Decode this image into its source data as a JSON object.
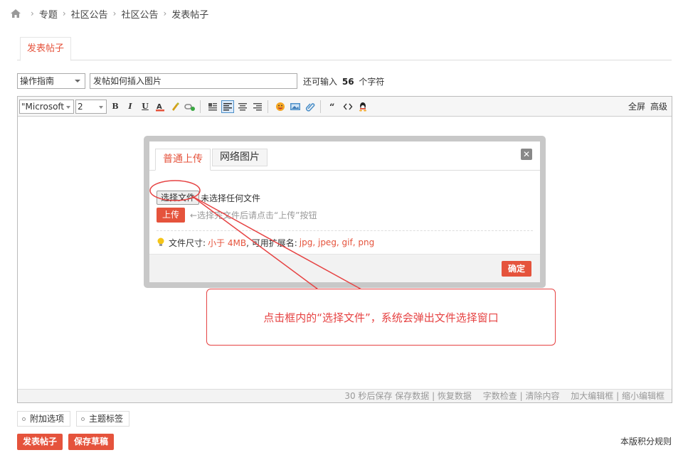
{
  "breadcrumb": {
    "items": [
      "专题",
      "社区公告",
      "社区公告",
      "发表帖子"
    ]
  },
  "tab": {
    "label": "发表帖子"
  },
  "subject": {
    "type_value": "操作指南",
    "title_value": "发帖如何插入图片",
    "remain_prefix": "还可输入",
    "remain_count": "56",
    "remain_suffix": "个字符"
  },
  "toolbar": {
    "font_value": "\"Microsoft",
    "size_value": "2",
    "bold": "B",
    "italic": "I",
    "underline": "U",
    "fullscreen": "全屏",
    "advanced": "高级"
  },
  "statusbar": {
    "autosave": "30 秒后保存",
    "save": "保存数据",
    "restore": "恢复数据",
    "check": "字数检查",
    "clear": "清除内容",
    "enlarge": "加大编辑框",
    "shrink": "缩小编辑框"
  },
  "modal": {
    "tab_local": "普通上传",
    "tab_web": "网络图片",
    "choose_file": "选择文件",
    "no_file": "未选择任何文件",
    "upload": "上传",
    "upload_hint": "←选择完文件后请点击“上传”按钮",
    "size_label": "文件尺寸:",
    "size_value": "小于 4MB",
    "ext_label": ", 可用扩展名:",
    "ext_value": "jpg, jpeg, gif, png",
    "ok": "确定"
  },
  "annotation": {
    "text": "点击框内的“选择文件”，系统会弹出文件选择窗口",
    "color": "#e64343"
  },
  "options": {
    "extra": "附加选项",
    "tags": "主题标签"
  },
  "actions": {
    "post": "发表帖子",
    "draft": "保存草稿",
    "rules": "本版积分规则"
  },
  "colors": {
    "accent": "#e5533c"
  }
}
